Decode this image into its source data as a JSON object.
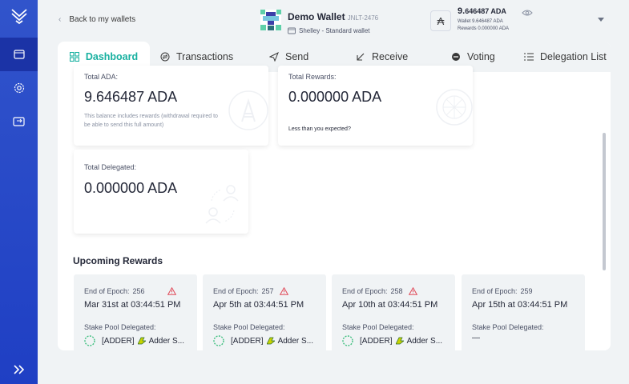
{
  "app": {
    "title": "Yoroi"
  },
  "sidebar": {
    "items": [
      {
        "name": "wallet-icon",
        "active": true
      },
      {
        "name": "settings-icon",
        "active": false
      },
      {
        "name": "transfer-icon",
        "active": false
      }
    ],
    "expand_icon": "double-chevron-right-icon"
  },
  "header": {
    "back_label": "Back to my wallets",
    "wallet_name": "Demo Wallet",
    "wallet_code": "JNLT-2476",
    "wallet_type": "Shelley - Standard wallet",
    "balance": "9.646487 ADA",
    "balance_integer": "9.",
    "balance_decimal": "646487 ADA",
    "wallet_line": "Wallet 9.646487 ADA",
    "rewards_line": "Rewards 0.000000 ADA"
  },
  "tabs": [
    {
      "label": "Dashboard",
      "icon": "dashboard-icon",
      "active": true
    },
    {
      "label": "Transactions",
      "icon": "transactions-icon",
      "active": false
    },
    {
      "label": "Send",
      "icon": "send-icon",
      "active": false
    },
    {
      "label": "Receive",
      "icon": "receive-icon",
      "active": false
    },
    {
      "label": "Voting",
      "icon": "voting-icon",
      "active": false
    },
    {
      "label": "Delegation List",
      "icon": "list-icon",
      "active": false
    }
  ],
  "dashboard": {
    "total_ada": {
      "label": "Total ADA:",
      "value": "9.646487 ADA",
      "note": "This balance includes rewards (withdrawal required to be able to send this full amount)"
    },
    "total_rewards": {
      "label": "Total Rewards:",
      "value": "0.000000 ADA",
      "link": "Less than you expected?"
    },
    "total_delegated": {
      "label": "Total Delegated:",
      "value": "0.000000 ADA"
    },
    "upcoming_title": "Upcoming Rewards",
    "upcoming": [
      {
        "epoch_label": "End of Epoch:",
        "epoch": "256",
        "warning": true,
        "date": "Mar 31st at 03:44:51 PM",
        "sp_label": "Stake Pool Delegated:",
        "pool": "[ADDER]",
        "pool_name": "Adder S..."
      },
      {
        "epoch_label": "End of Epoch:",
        "epoch": "257",
        "warning": true,
        "date": "Apr 5th at 03:44:51 PM",
        "sp_label": "Stake Pool Delegated:",
        "pool": "[ADDER]",
        "pool_name": "Adder S..."
      },
      {
        "epoch_label": "End of Epoch:",
        "epoch": "258",
        "warning": true,
        "date": "Apr 10th at 03:44:51 PM",
        "sp_label": "Stake Pool Delegated:",
        "pool": "[ADDER]",
        "pool_name": "Adder S..."
      },
      {
        "epoch_label": "End of Epoch:",
        "epoch": "259",
        "warning": false,
        "date": "Apr 15th at 03:44:51 PM",
        "sp_label": "Stake Pool Delegated:",
        "pool": "—",
        "pool_name": ""
      }
    ]
  },
  "colors": {
    "sidebar": "#2a4bc9",
    "sidebar_active": "#1b33a6",
    "accent": "#17b0a0",
    "warning": "#e04b5a",
    "background": "#f0f3f5"
  }
}
